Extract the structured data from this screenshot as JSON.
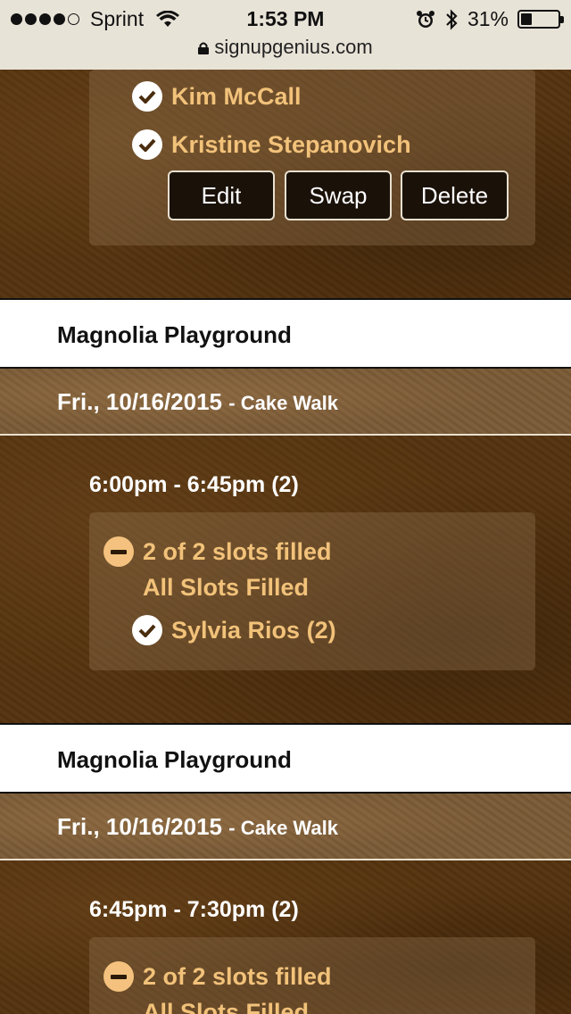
{
  "status_bar": {
    "carrier": "Sprint",
    "time": "1:53 PM",
    "battery_percent": "31%",
    "battery_level": 0.31,
    "url": "signupgenius.com"
  },
  "top_section": {
    "names": [
      "Kim McCall",
      "Kristine Stepanovich"
    ],
    "buttons": {
      "edit": "Edit",
      "swap": "Swap",
      "delete": "Delete"
    }
  },
  "sections": [
    {
      "location": "Magnolia Playground",
      "date": "Fri., 10/16/2015",
      "event": "- Cake Walk",
      "time": "6:00pm - 6:45pm (2)",
      "slots": "2 of 2 slots filled",
      "filled_label": "All Slots Filled",
      "volunteer": "Sylvia Rios (2)"
    },
    {
      "location": "Magnolia Playground",
      "date": "Fri., 10/16/2015",
      "event": "- Cake Walk",
      "time": "6:45pm - 7:30pm (2)",
      "slots": "2 of 2 slots filled",
      "filled_label": "All Slots Filled"
    }
  ],
  "colors": {
    "accent_gold": "#f2c27a",
    "leather_dark": "#55330f",
    "leather_light": "#7a5a36"
  },
  "icons": [
    "wifi-icon",
    "lock-icon",
    "alarm-icon",
    "bluetooth-icon",
    "battery-icon",
    "check-circle-icon",
    "minus-circle-icon"
  ]
}
